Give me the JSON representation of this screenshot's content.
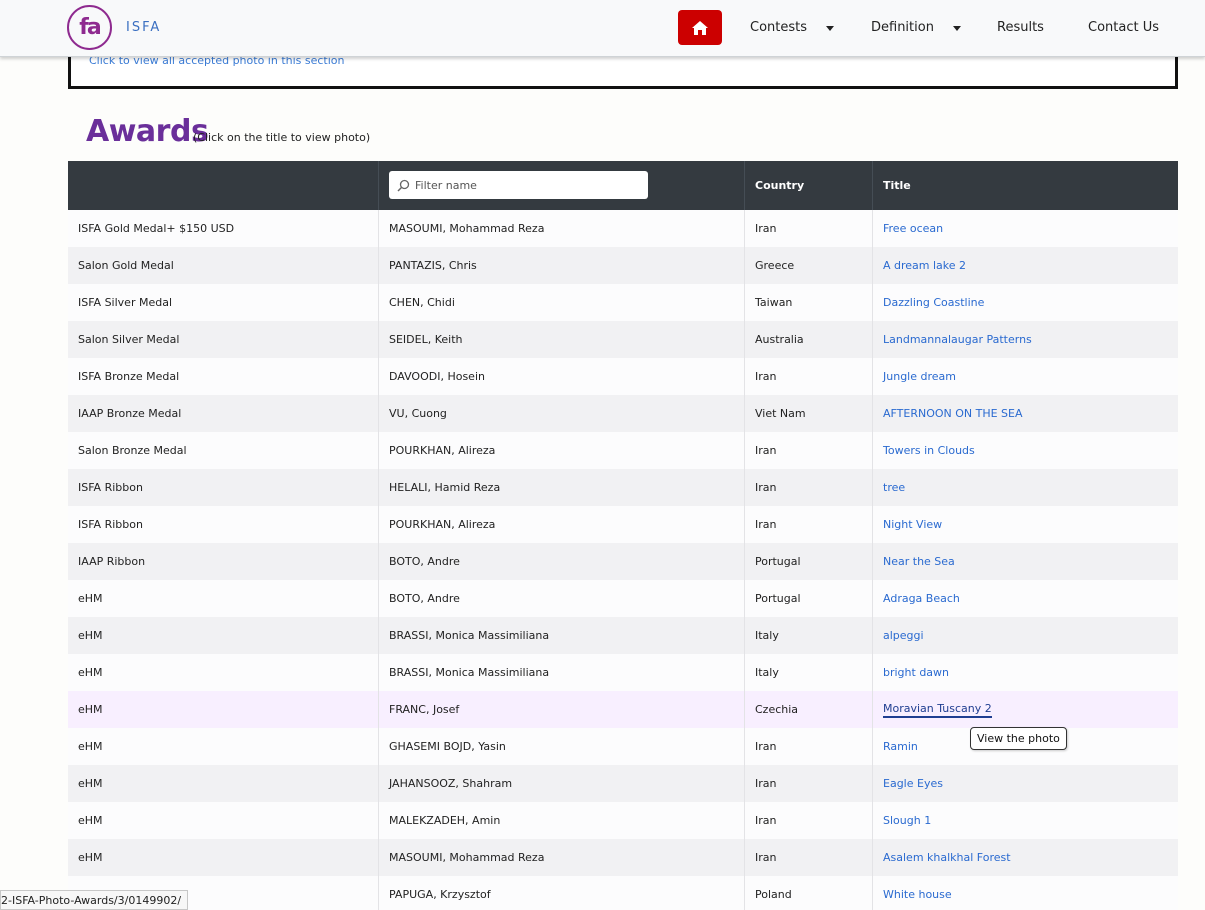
{
  "brand": {
    "logo_text": "fa",
    "name": "ISFA"
  },
  "nav": {
    "home_icon": "home-icon",
    "items": [
      {
        "label": "Contests",
        "has_caret": true
      },
      {
        "label": "Definition",
        "has_caret": true
      },
      {
        "label": "Results",
        "has_caret": false
      },
      {
        "label": "Contact Us",
        "has_caret": false
      }
    ]
  },
  "accepted": {
    "link_text": "Click to view all accepted photo in this section"
  },
  "awards": {
    "title": "Awards",
    "subtitle": "(Click on the title to view photo)"
  },
  "table": {
    "filter_placeholder": "Filter name",
    "headers": {
      "award": "",
      "name": "",
      "country": "Country",
      "title": "Title"
    },
    "rows": [
      {
        "award": "ISFA Gold Medal+ $150 USD",
        "name": "MASOUMI, Mohammad Reza",
        "country": "Iran",
        "title": "Free ocean"
      },
      {
        "award": "Salon Gold Medal",
        "name": "PANTAZIS, Chris",
        "country": "Greece",
        "title": "A dream lake 2"
      },
      {
        "award": "ISFA Silver Medal",
        "name": "CHEN, Chidi",
        "country": "Taiwan",
        "title": "Dazzling Coastline"
      },
      {
        "award": "Salon Silver Medal",
        "name": "SEIDEL, Keith",
        "country": "Australia",
        "title": "Landmannalaugar Patterns"
      },
      {
        "award": "ISFA Bronze Medal",
        "name": "DAVOODI, Hosein",
        "country": "Iran",
        "title": "Jungle dream"
      },
      {
        "award": "IAAP Bronze Medal",
        "name": "VU, Cuong",
        "country": "Viet Nam",
        "title": "AFTERNOON ON THE SEA"
      },
      {
        "award": "Salon Bronze Medal",
        "name": "POURKHAN, Alireza",
        "country": "Iran",
        "title": "Towers in Clouds"
      },
      {
        "award": "ISFA Ribbon",
        "name": "HELALI, Hamid Reza",
        "country": "Iran",
        "title": "tree"
      },
      {
        "award": "ISFA Ribbon",
        "name": "POURKHAN, Alireza",
        "country": "Iran",
        "title": "Night View"
      },
      {
        "award": "IAAP Ribbon",
        "name": "BOTO, Andre",
        "country": "Portugal",
        "title": "Near the Sea"
      },
      {
        "award": "eHM",
        "name": "BOTO, Andre",
        "country": "Portugal",
        "title": "Adraga Beach"
      },
      {
        "award": "eHM",
        "name": "BRASSI, Monica Massimiliana",
        "country": "Italy",
        "title": "alpeggi"
      },
      {
        "award": "eHM",
        "name": "BRASSI, Monica Massimiliana",
        "country": "Italy",
        "title": "bright dawn"
      },
      {
        "award": "eHM",
        "name": "FRANC, Josef",
        "country": "Czechia",
        "title": "Moravian Tuscany 2"
      },
      {
        "award": "eHM",
        "name": "GHASEMI BOJD, Yasin",
        "country": "Iran",
        "title": "Ramin"
      },
      {
        "award": "eHM",
        "name": "JAHANSOOZ, Shahram",
        "country": "Iran",
        "title": "Eagle Eyes"
      },
      {
        "award": "eHM",
        "name": "MALEKZADEH, Amin",
        "country": "Iran",
        "title": "Slough 1"
      },
      {
        "award": "eHM",
        "name": "MASOUMI, Mohammad Reza",
        "country": "Iran",
        "title": "Asalem khalkhal Forest"
      },
      {
        "award": "",
        "name": "PAPUGA, Krzysztof",
        "country": "Poland",
        "title": "White house"
      }
    ]
  },
  "tooltip": {
    "text": "View the photo"
  },
  "statusbar": {
    "url_text": "2-ISFA-Photo-Awards/3/0149902/"
  },
  "colors": {
    "home_button": "#cc0000",
    "awards_title": "#6a2f9a",
    "header_bg": "#343a40",
    "link": "#2a6ad0",
    "brand": "#8e2a8f"
  }
}
